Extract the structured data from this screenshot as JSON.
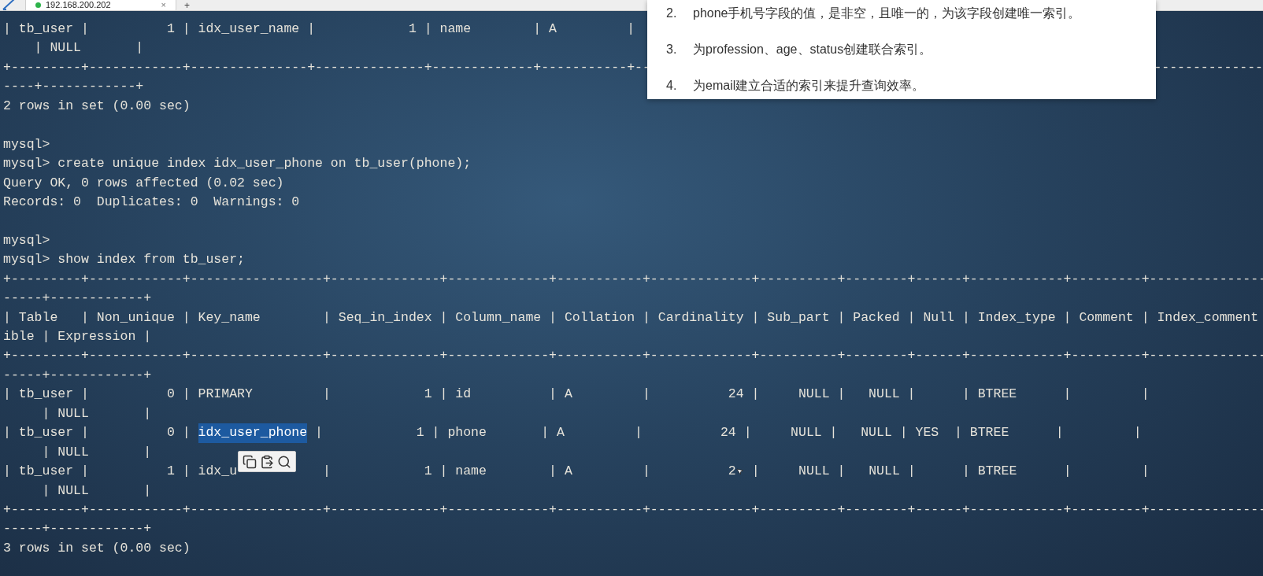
{
  "tab_bar": {
    "tabs": [
      {
        "label": "192.168.200.202",
        "selected": true,
        "close": "×"
      }
    ],
    "new_tab": "+"
  },
  "terminal": {
    "lines": [
      {
        "text": "| tb_user |          1 | idx_user_name |            1 | name        | A         |"
      },
      {
        "text": "    | NULL       |"
      },
      {
        "kind": "split",
        "text": "+---------+------------+---------------+--------------+-------------+-----------+--",
        "tail": "--------------"
      },
      {
        "text": "----+------------+"
      },
      {
        "text": "2 rows in set (0.00 sec)"
      },
      {
        "kind": "blank"
      },
      {
        "text": "mysql>"
      },
      {
        "text": "mysql> create unique index idx_user_phone on tb_user(phone);"
      },
      {
        "text": "Query OK, 0 rows affected (0.02 sec)"
      },
      {
        "text": "Records: 0  Duplicates: 0  Warnings: 0"
      },
      {
        "kind": "blank"
      },
      {
        "text": "mysql>"
      },
      {
        "text": "mysql> show index from tb_user;"
      },
      {
        "text": "+---------+------------+-----------------+--------------+-------------+-----------+-------------+----------+--------+------+------------+---------+---------------"
      },
      {
        "text": "-----+------------+"
      },
      {
        "text": "| Table   | Non_unique | Key_name        | Seq_in_index | Column_name | Collation | Cardinality | Sub_part | Packed | Null | Index_type | Comment | Index_comment"
      },
      {
        "text": "ible | Expression |"
      },
      {
        "text": "+---------+------------+-----------------+--------------+-------------+-----------+-------------+----------+--------+------+------------+---------+---------------"
      },
      {
        "text": "-----+------------+"
      },
      {
        "text": "| tb_user |          0 | PRIMARY         |            1 | id          | A         |          24 |     NULL |   NULL |      | BTREE      |         |"
      },
      {
        "text": "     | NULL       |"
      },
      {
        "kind": "segments",
        "segments": [
          {
            "text": "| tb_user |          0 | ",
            "selected": false
          },
          {
            "text": "idx_user_phone",
            "selected": true
          },
          {
            "text": " |            1 | phone       | A         |          24 |     NULL |   NULL | YES  | BTREE      |         |",
            "selected": false
          }
        ]
      },
      {
        "text": "     | NULL       |"
      },
      {
        "kind": "pointer",
        "text": "| tb_user |          1 | idx_u           |            1 | name        | A         |          2",
        "tail": " |     NULL |   NULL |      | BTREE      |         |"
      },
      {
        "text": "     | NULL       |"
      },
      {
        "text": "+---------+------------+-----------------+--------------+-------------+-----------+-------------+----------+--------+------+------------+---------+---------------"
      },
      {
        "text": "-----+------------+"
      },
      {
        "text": "3 rows in set (0.00 sec)"
      }
    ]
  },
  "task_panel": {
    "items": [
      {
        "number": "2.",
        "text": "phone手机号字段的值，是非空，且唯一的，为该字段创建唯一索引。"
      },
      {
        "number": "3.",
        "text": "为profession、age、status创建联合索引。"
      },
      {
        "number": "4.",
        "text": "为email建立合适的索引来提升查询效率。"
      }
    ]
  }
}
